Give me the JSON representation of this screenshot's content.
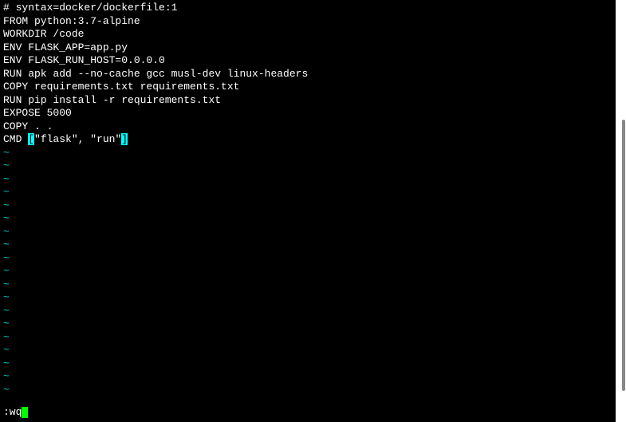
{
  "editor": {
    "lines": [
      "# syntax=docker/dockerfile:1",
      "FROM python:3.7-alpine",
      "WORKDIR /code",
      "ENV FLASK_APP=app.py",
      "ENV FLASK_RUN_HOST=0.0.0.0",
      "RUN apk add --no-cache gcc musl-dev linux-headers",
      "COPY requirements.txt requirements.txt",
      "RUN pip install -r requirements.txt",
      "EXPOSE 5000",
      "COPY . ."
    ],
    "cmd_line_prefix": "CMD ",
    "cmd_bracket_open": "[",
    "cmd_content": "\"flask\", \"run\"",
    "cmd_bracket_close": "]",
    "tilde": "~",
    "command": ":wq"
  }
}
